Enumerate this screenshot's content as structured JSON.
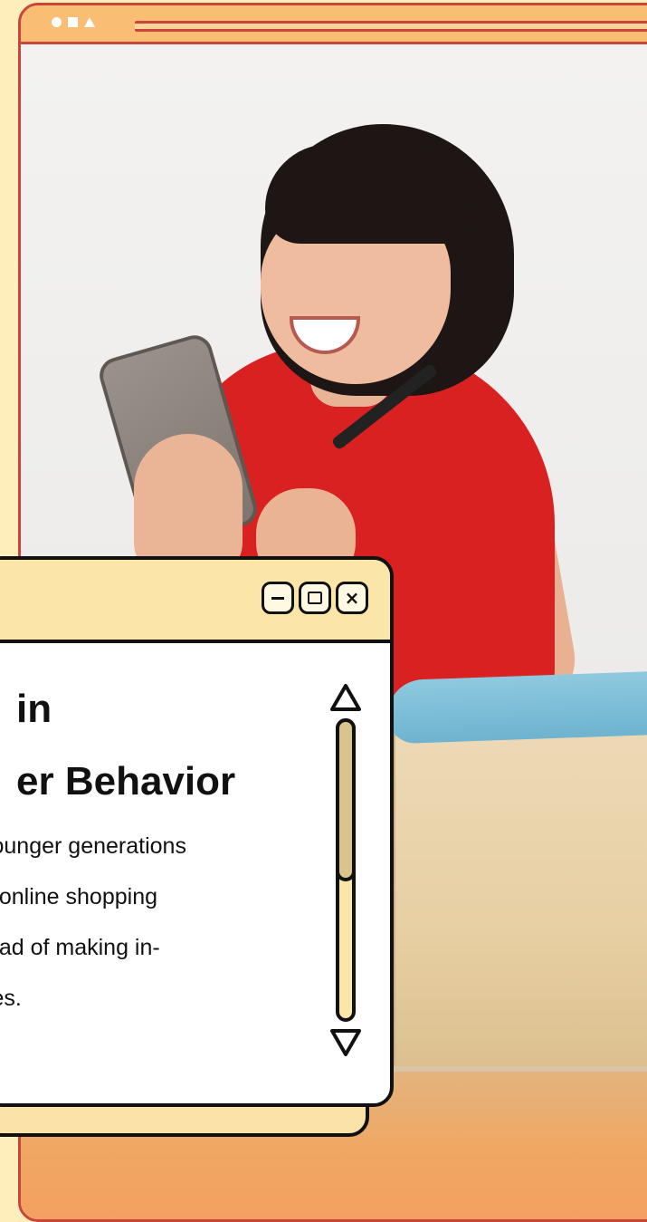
{
  "window": {
    "title_line1": "in",
    "title_line2": "er Behavior",
    "body_lines": [
      "younger generations",
      "o online shopping",
      "tead of making in-",
      "ses."
    ],
    "controls": {
      "minimize_icon": "minimize-icon",
      "maximize_icon": "maximize-icon",
      "close_symbol": "×"
    }
  },
  "colors": {
    "page_background": "#fdeebc",
    "browser_frame": "#c9453a",
    "browser_bar": "#f9bd73",
    "window_titlebar": "#fce5a9",
    "scroll_thumb": "#d8c48c",
    "shirt_red": "#d92121"
  },
  "icons": {
    "browser_dots": [
      "circle-icon",
      "square-icon",
      "triangle-icon"
    ],
    "scroll_up": "triangle-up-icon",
    "scroll_down": "triangle-down-icon"
  }
}
